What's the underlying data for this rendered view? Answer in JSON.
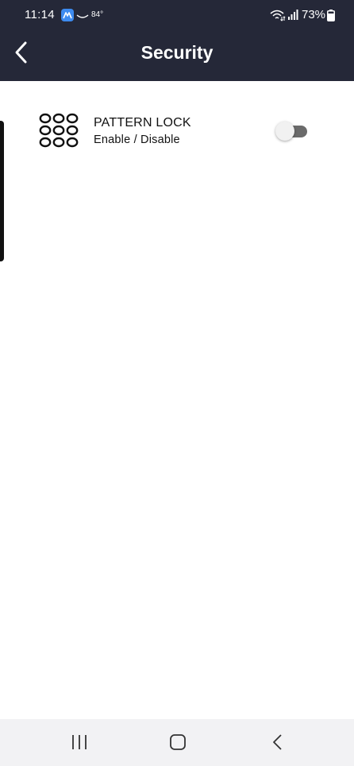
{
  "status_bar": {
    "time": "11:14",
    "temperature": "84°",
    "battery_percent": "73%",
    "icons": [
      "app-notification-icon",
      "weather-icon",
      "wifi-icon",
      "signal-icon",
      "battery-icon"
    ]
  },
  "header": {
    "title": "Security",
    "back_icon": "chevron-left-icon",
    "background_color": "#252838"
  },
  "settings": [
    {
      "icon": "pattern-lock-icon",
      "title": "PATTERN LOCK",
      "subtitle": "Enable / Disable",
      "toggle_on": false
    }
  ],
  "nav_bar": {
    "buttons": [
      "recents-icon",
      "home-icon",
      "back-icon"
    ]
  }
}
